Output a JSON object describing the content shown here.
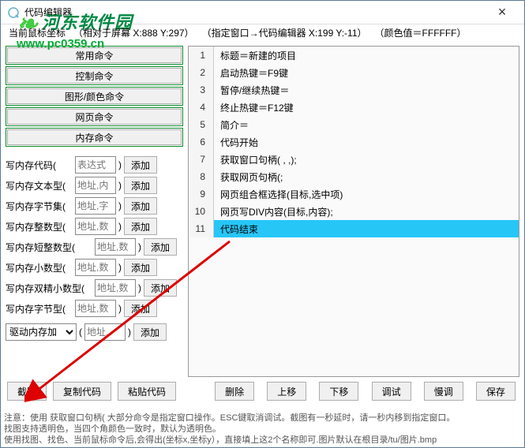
{
  "window": {
    "title": "代码编辑器"
  },
  "status": {
    "label": "当前鼠标坐标",
    "screen": "（相对于屏幕 X:888 Y:297）",
    "win": "（指定窗口→代码编辑器   X:199 Y:-11）",
    "color": "（颜色值＝FFFFFF）"
  },
  "watermark": {
    "line1": "河东软件园",
    "line2": "www.pc0359.cn"
  },
  "cmd_buttons": [
    "常用命令",
    "控制命令",
    "图形/颜色命令",
    "网页命令",
    "内存命令"
  ],
  "rows": [
    {
      "label": "写内存代码",
      "ph": "表达式",
      "btn": "添加",
      "long": false
    },
    {
      "label": "写内存文本型",
      "ph": "地址,内",
      "btn": "添加",
      "long": false
    },
    {
      "label": "写内存字节集",
      "ph": "地址,字",
      "btn": "添加",
      "long": false
    },
    {
      "label": "写内存整数型",
      "ph": "地址,数",
      "btn": "添加",
      "long": false
    },
    {
      "label": "写内存短整数型",
      "ph": "地址,数",
      "btn": "添加",
      "long": true
    },
    {
      "label": "写内存小数型",
      "ph": "地址,数",
      "btn": "添加",
      "long": false
    },
    {
      "label": "写内存双精小数型",
      "ph": "地址,数",
      "btn": "添加",
      "long": true
    },
    {
      "label": "写内存字节型",
      "ph": "地址,数",
      "btn": "添加",
      "long": false
    }
  ],
  "drv": {
    "select": "驱动内存加",
    "ph": "地址,",
    "btn": "添加"
  },
  "code": [
    "标题＝新建的项目",
    "启动热键＝F9键",
    "暂停/继续热键＝",
    "终止热键＝F12键",
    "简介＝",
    "代码开始",
    "获取窗口句柄(                                                                       ,                ,);",
    "获取网页句柄(;",
    "网页组合框选择(目标,选中项)",
    "网页写DIV内容(目标,内容);",
    "代码结束"
  ],
  "selected": 10,
  "left_btns": [
    "截图",
    "复制代码",
    "粘贴代码"
  ],
  "right_btns": [
    "删除",
    "上移",
    "下移",
    "调试",
    "慢调",
    "保存"
  ],
  "notes": [
    "注意：使用 获取窗口句柄( 大部分命令是指定窗口操作。ESC键取消调试。截图有一秒延时，请一秒内移到指定窗口。",
    "找图支持透明色，当四个角颜色一致时，默认为透明色。",
    "使用找图、找色、当前鼠标命令后,会得出(坐标x,坐标y），直接填上这2个名称即可.图片默认在根目录/tu/图片.bmp"
  ]
}
